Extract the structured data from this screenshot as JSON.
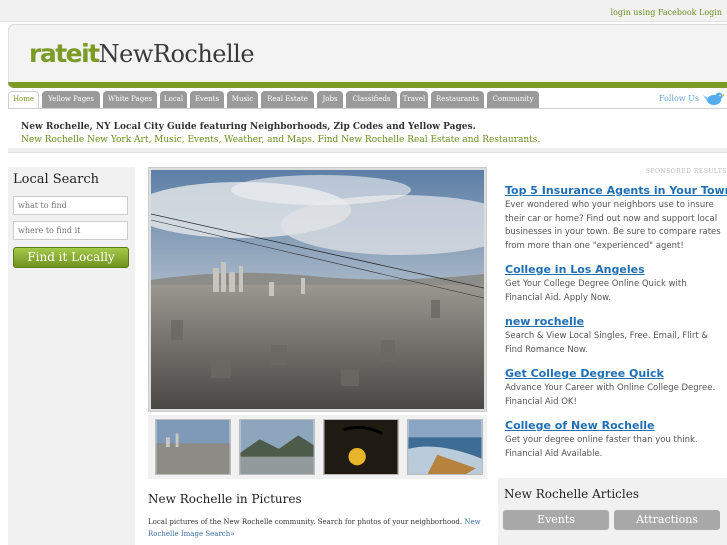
{
  "topbar": {
    "login": "login using Facebook Login"
  },
  "logo": {
    "rateit": "rateit",
    "city": "NewRochelle"
  },
  "nav": {
    "tabs": [
      "Home",
      "Yellow Pages",
      "White Pages",
      "Local",
      "Events",
      "Music",
      "Real Estate",
      "Jobs",
      "Classifieds",
      "Travel",
      "Restaurants",
      "Community"
    ],
    "follow": "Follow Us"
  },
  "intro": {
    "line1": "New Rochelle, NY Local City Guide featuring Neighborhoods, Zip Codes and Yellow Pages.",
    "line2": "New Rochelle New York Art, Music, Events, Weather, and Maps. Find New Rochelle Real Estate and Restaurants."
  },
  "local_search": {
    "title": "Local Search",
    "what_placeholder": "what to find",
    "where_placeholder": "where to find it",
    "button": "Find it Locally"
  },
  "pictures": {
    "title": "New Rochelle in Pictures",
    "text": "Local pictures of the New Rochelle community. Search for photos of your neighborhood.",
    "link": "New Rochelle Image Search»"
  },
  "sponsored": "SPONSORED RESULTS",
  "ads": [
    {
      "title": "Top 5 Insurance Agents in Your Town",
      "desc": "Ever wondered who your neighbors use to insure their car or home? Find out now and support local businesses in your town. Be sure to compare rates from more than one \"experienced\" agent!"
    },
    {
      "title": "College in Los Angeles",
      "desc": "Get Your College Degree Online Quick with Financial Aid. Apply Now."
    },
    {
      "title": "new rochelle",
      "desc": "Search & View Local Singles, Free. Email, Flirt & Find Romance Now."
    },
    {
      "title": "Get College Degree Quick",
      "desc": "Advance Your Career with Online College Degree. Financial Aid OK!"
    },
    {
      "title": "College of New Rochelle",
      "desc": "Get your degree online faster than you think. Financial Aid Available."
    }
  ],
  "articles": {
    "title": "New Rochelle Articles",
    "buttons": [
      "Events",
      "Attractions"
    ]
  }
}
